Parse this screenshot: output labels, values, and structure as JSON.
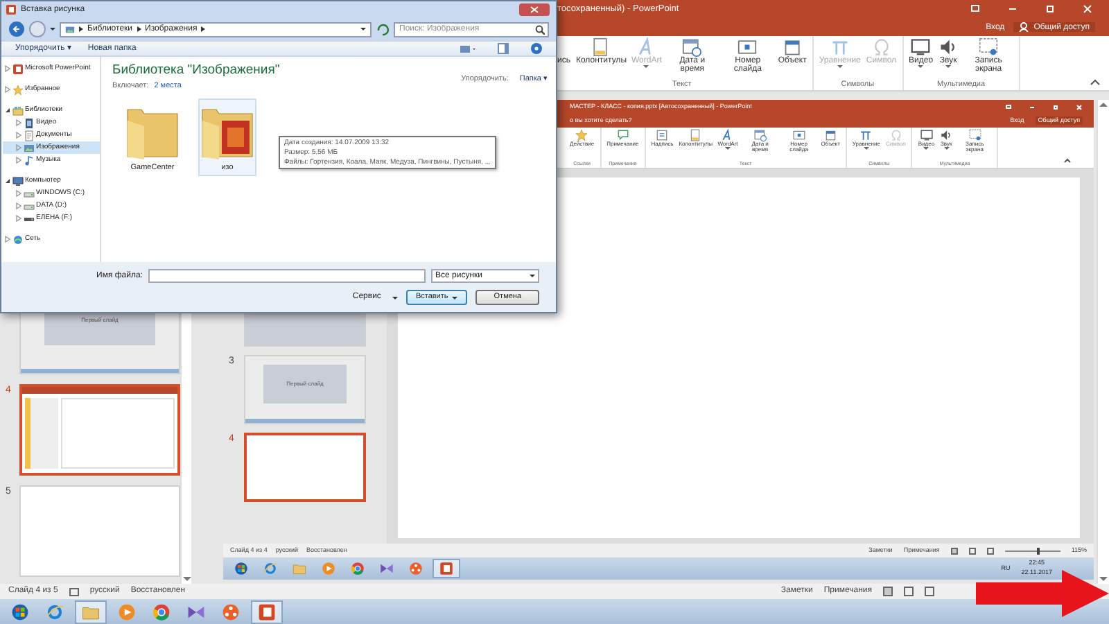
{
  "app": {
    "title": "тосохраненный) - PowerPoint",
    "sign_in": "Вход",
    "share": "Общий доступ",
    "ribbon": [
      {
        "label": "Текст",
        "commands": [
          {
            "label": "ись",
            "disabled": false,
            "dropdown": false
          },
          {
            "label": "Колонтитулы",
            "kind": "page",
            "disabled": false,
            "dropdown": false
          },
          {
            "label": "WordArt",
            "kind": "letter",
            "disabled": true,
            "dropdown": true
          },
          {
            "label": "Дата и время",
            "kind": "calendar",
            "disabled": false,
            "dropdown": false
          },
          {
            "label": "Номер слайда",
            "kind": "number",
            "disabled": false,
            "dropdown": false
          },
          {
            "label": "Объект",
            "kind": "object",
            "disabled": false,
            "dropdown": false
          }
        ]
      },
      {
        "label": "Символы",
        "commands": [
          {
            "label": "Уравнение",
            "kind": "pi",
            "disabled": true,
            "dropdown": true
          },
          {
            "label": "Символ",
            "kind": "omega",
            "disabled": true,
            "dropdown": false
          }
        ]
      },
      {
        "label": "Мультимедиа",
        "commands": [
          {
            "label": "Видео",
            "kind": "screen",
            "disabled": false,
            "dropdown": true
          },
          {
            "label": "Звук",
            "kind": "speaker",
            "disabled": false,
            "dropdown": true
          },
          {
            "label": "Запись экрана",
            "kind": "record",
            "disabled": false,
            "dropdown": false
          }
        ]
      }
    ],
    "slides": [
      {
        "kind": "title-screen",
        "caption": "Первый слайд",
        "selected": false
      },
      {
        "number": "4",
        "kind": "screen",
        "selected": true
      },
      {
        "number": "5",
        "kind": "blank",
        "selected": false
      }
    ],
    "status_bar": {
      "slide": "Слайд 4 из 5",
      "language": "русский",
      "state": "Восстановлен",
      "notes": "Заметки",
      "comments": "Примечания"
    },
    "taskbar": [
      {
        "kind": "start",
        "active": false
      },
      {
        "kind": "ie",
        "active": false
      },
      {
        "kind": "folder",
        "active": true
      },
      {
        "kind": "media",
        "active": false
      },
      {
        "kind": "chrome",
        "active": false
      },
      {
        "kind": "vs",
        "active": false
      },
      {
        "kind": "hub",
        "active": false
      },
      {
        "kind": "ppt",
        "active": true
      }
    ]
  },
  "slide_content": {
    "title": "МАСТЕР - КЛАСС - копия.pptx [Автосохраненный] - PowerPoint",
    "search_hint": "о вы хотите сделать?",
    "sign_in": "Вход",
    "share": "Общий доступ",
    "ribbon": [
      {
        "label": "Ссылки",
        "commands": [
          {
            "label": "Действие",
            "kind": "star",
            "disabled": false,
            "dropdown": false
          }
        ]
      },
      {
        "label": "Примечания",
        "commands": [
          {
            "label": "Примечание",
            "kind": "comment",
            "disabled": false,
            "dropdown": false
          }
        ]
      },
      {
        "label": "Текст",
        "commands": [
          {
            "label": "Надпись",
            "kind": "textbox",
            "disabled": false,
            "dropdown": false
          },
          {
            "label": "Колонтитулы",
            "kind": "page",
            "disabled": false,
            "dropdown": false
          },
          {
            "label": "WordArt",
            "kind": "letter",
            "disabled": false,
            "dropdown": true
          },
          {
            "label": "Дата и время",
            "kind": "calendar",
            "disabled": false,
            "dropdown": false
          },
          {
            "label": "Номер слайда",
            "kind": "number",
            "disabled": false,
            "dropdown": false
          },
          {
            "label": "Объект",
            "kind": "object",
            "disabled": false,
            "dropdown": false
          }
        ]
      },
      {
        "label": "Символы",
        "commands": [
          {
            "label": "Уравнение",
            "kind": "pi",
            "disabled": false,
            "dropdown": true
          },
          {
            "label": "Символ",
            "kind": "omega",
            "disabled": true,
            "dropdown": false
          }
        ]
      },
      {
        "label": "Мультимедиа",
        "commands": [
          {
            "label": "Видео",
            "kind": "screen",
            "disabled": false,
            "dropdown": true
          },
          {
            "label": "Звук",
            "kind": "speaker",
            "disabled": false,
            "dropdown": true
          },
          {
            "label": "Запись экрана",
            "kind": "record",
            "disabled": false,
            "dropdown": false
          }
        ]
      }
    ],
    "slides": [
      {
        "kind": "blank-gray",
        "selected": false
      },
      {
        "number": "3",
        "kind": "title-screen",
        "caption": "Первый слайд",
        "selected": false
      },
      {
        "number": "4",
        "kind": "blank",
        "selected": true
      }
    ],
    "status_bar": {
      "slide": "Слайд 4 из 4",
      "language": "русский",
      "state": "Восстановлен",
      "notes": "Заметки",
      "comments": "Примечания",
      "zoom": "115%",
      "zoom_slider": {
        "level": 0.6
      }
    },
    "taskbar": [
      {
        "kind": "start",
        "active": false
      },
      {
        "kind": "ie",
        "active": false
      },
      {
        "kind": "folder",
        "active": false
      },
      {
        "kind": "media",
        "active": false
      },
      {
        "kind": "chrome",
        "active": false
      },
      {
        "kind": "vs",
        "active": false
      },
      {
        "kind": "hub",
        "active": false
      },
      {
        "kind": "ppt",
        "active": true
      }
    ],
    "tray": {
      "language": "RU",
      "time": "22:45",
      "date": "22.11.2017"
    }
  },
  "dialog": {
    "title": "Вставка рисунка",
    "breadcrumb": [
      "Библиотеки",
      "Изображения"
    ],
    "search": {
      "placeholder": "Поиск: Изображения"
    },
    "toolbar": {
      "organize": "Упорядочить ▾",
      "new_folder": "Новая папка"
    },
    "nav": [
      {
        "label": "Microsoft PowerPoint",
        "kind": "ppt",
        "expanded": false,
        "selected": false
      },
      {
        "label": "Избранное",
        "kind": "star",
        "expanded": false,
        "selected": false
      },
      {
        "label": "Библиотеки",
        "kind": "library",
        "expanded": true,
        "selected": false,
        "children": [
          {
            "label": "Видео",
            "kind": "video",
            "expanded": false,
            "selected": false
          },
          {
            "label": "Документы",
            "kind": "doc",
            "expanded": false,
            "selected": false
          },
          {
            "label": "Изображения",
            "kind": "pictures",
            "expanded": false,
            "selected": true
          },
          {
            "label": "Музыка",
            "kind": "music",
            "expanded": false,
            "selected": false
          }
        ]
      },
      {
        "label": "Компьютер",
        "kind": "computer",
        "expanded": true,
        "selected": false,
        "children": [
          {
            "label": "WINDOWS (C:)",
            "kind": "drive",
            "expanded": false,
            "selected": false
          },
          {
            "label": "DATA (D:)",
            "kind": "drive",
            "expanded": false,
            "selected": false
          },
          {
            "label": "ЕЛЕНА (F:)",
            "kind": "usb",
            "expanded": false,
            "selected": false
          }
        ]
      },
      {
        "label": "Сеть",
        "kind": "network",
        "expanded": false,
        "selected": false
      }
    ],
    "heading": "Библиотека \"Изображения\"",
    "includes_label": "Включает:",
    "includes_link": "2 места",
    "arrange_label": "Упорядочить:",
    "arrange_value": "Папка ▾",
    "files": [
      {
        "label": "GameCenter",
        "kind": "folder",
        "selected": false
      },
      {
        "label": "изо",
        "kind": "picture-folder",
        "selected": true
      }
    ],
    "tooltip": [
      "Дата создания: 14.07.2009 13:32",
      "Размер: 5,56 МБ",
      "Файлы: Гортензия, Коала, Маяк, Медуза, Пингвины, Пустыня, ..."
    ],
    "file_name_label": "Имя файла:",
    "file_type": "Все рисунки",
    "tools": "Сервис",
    "insert": "Вставить",
    "cancel": "Отмена"
  }
}
